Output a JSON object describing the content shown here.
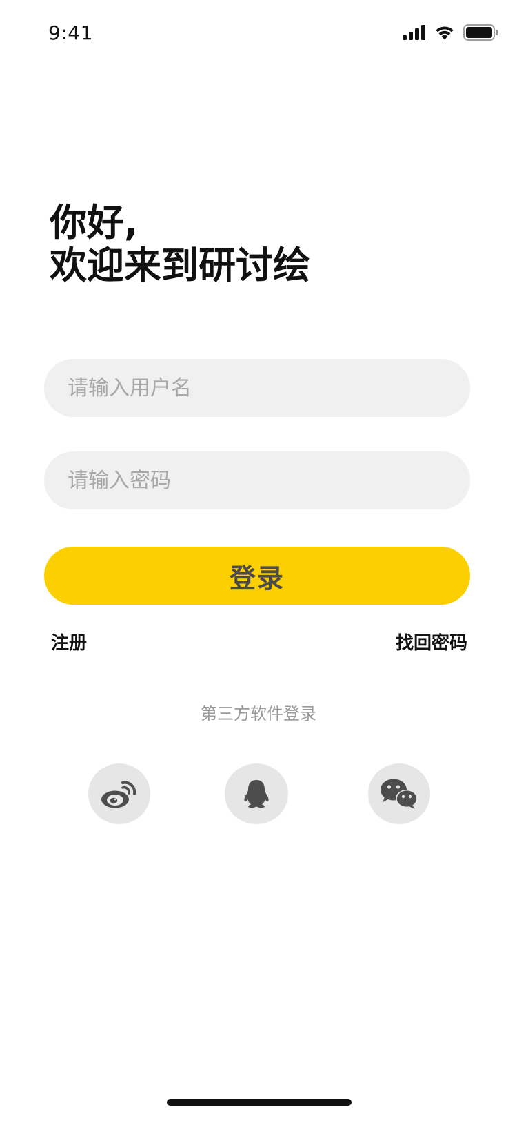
{
  "status_bar": {
    "time": "9:41",
    "icons": [
      "signal-icon",
      "wifi-icon",
      "battery-icon"
    ]
  },
  "greeting": {
    "line1": "你好,",
    "line2": "欢迎来到研讨绘"
  },
  "form": {
    "username_placeholder": "请输入用户名",
    "username_value": "",
    "password_placeholder": "请输入密码",
    "password_value": "",
    "login_label": "登录"
  },
  "links": {
    "register": "注册",
    "forgot_password": "找回密码"
  },
  "third_party": {
    "label": "第三方软件登录",
    "providers": [
      "weibo-icon",
      "qq-icon",
      "wechat-icon"
    ]
  },
  "colors": {
    "accent": "#fcd000",
    "input_bg": "#f0f0f0",
    "social_bg": "#e6e6e6",
    "muted_text": "#9a9a9a"
  }
}
